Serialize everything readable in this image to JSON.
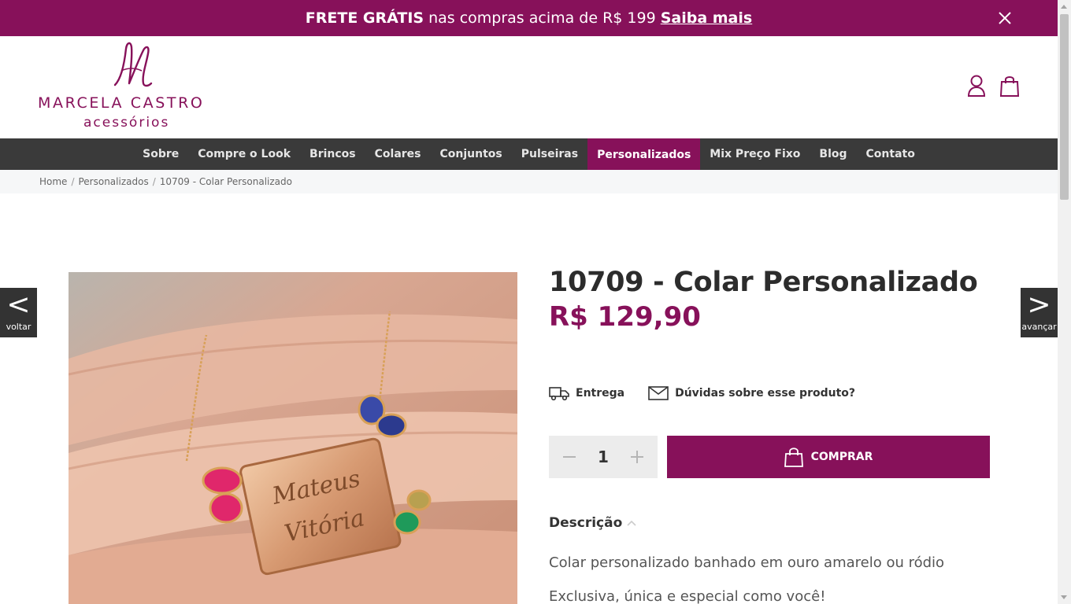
{
  "promo": {
    "bold": "FRETE GRÁTIS",
    "text": "nas compras acima de R$ 199",
    "link": "Saiba mais"
  },
  "header": {
    "brand_line1": "MARCELA CASTRO",
    "brand_line2": "acessórios",
    "icons": [
      "user-icon",
      "shopping-bag-icon"
    ]
  },
  "nav": {
    "items": [
      {
        "label": "Sobre"
      },
      {
        "label": "Compre o Look"
      },
      {
        "label": "Brincos"
      },
      {
        "label": "Colares"
      },
      {
        "label": "Conjuntos"
      },
      {
        "label": "Pulseiras"
      },
      {
        "label": "Personalizados",
        "active": true
      },
      {
        "label": "Mix Preço Fixo"
      },
      {
        "label": "Blog"
      },
      {
        "label": "Contato"
      }
    ]
  },
  "breadcrumb": [
    "Home",
    "Personalizados",
    "10709 - Colar Personalizado"
  ],
  "arrows": {
    "prev": "<",
    "prev_label": "voltar",
    "next": ">",
    "next_label": "avançar"
  },
  "product": {
    "title": "10709 - Colar Personalizado",
    "price": "R$ 129,90",
    "delivery_label": "Entrega",
    "question_label": "Dúvidas sobre esse produto?",
    "quantity": "1",
    "buy_label": "COMPRAR",
    "description_title": "Descrição",
    "description_p1": "Colar personalizado banhado em ouro amarelo ou ródio",
    "description_p2": "Exclusiva, única e especial como você!",
    "engraving_line1": "Mateus",
    "engraving_line2": "Vitória"
  },
  "colors": {
    "brand": "#87115a",
    "nav_bg": "#3a3a3a"
  }
}
